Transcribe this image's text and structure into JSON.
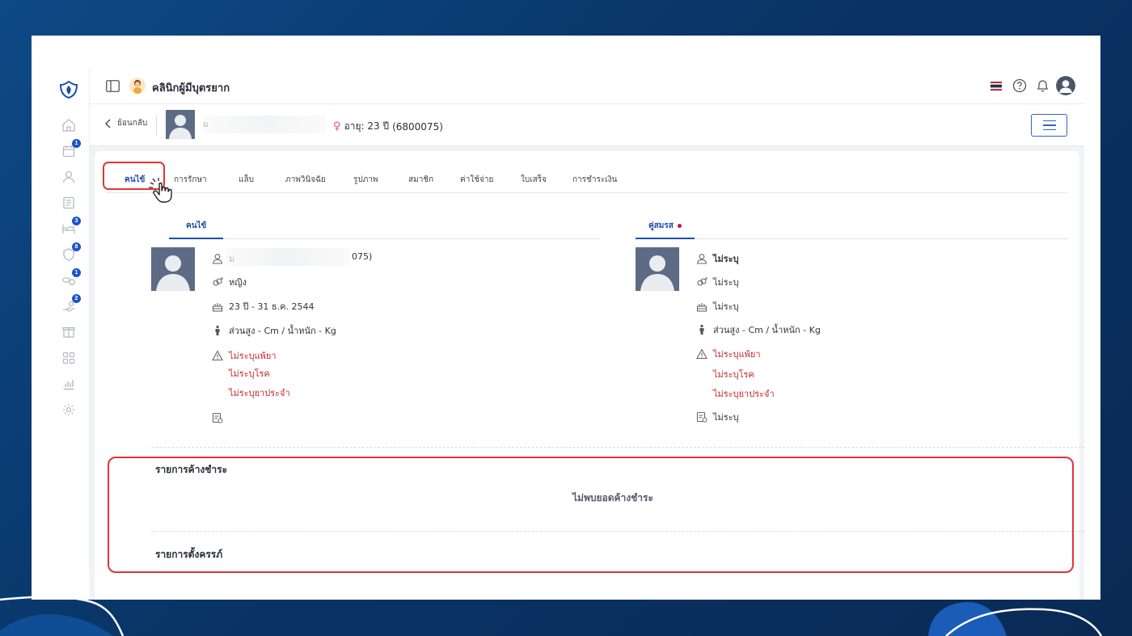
{
  "clinic": {
    "name": "คลินิกผู้มีบุตรยาก"
  },
  "header": {
    "back_label": "ย้อนกลับ",
    "name_initial": "ม",
    "age_text": "อายุ: 23 ปี",
    "hn_text": "(6800075)",
    "gender_symbol": "♀"
  },
  "tabs": [
    {
      "label": "คนไข้",
      "active": true
    },
    {
      "label": "การรักษา"
    },
    {
      "label": "แล็บ"
    },
    {
      "label": "ภาพวินิจฉัย"
    },
    {
      "label": "รูปภาพ"
    },
    {
      "label": "สมาชิก"
    },
    {
      "label": "ค่าใช้จ่าย"
    },
    {
      "label": "ใบเสร็จ"
    },
    {
      "label": "การชำระเงิน"
    }
  ],
  "sidebar": {
    "badges": {
      "appointments": "1",
      "beds": "3",
      "shield": "8",
      "pills": "1",
      "hand": "2"
    }
  },
  "patient": {
    "tab_label": "คนไข้",
    "name_initial": "ม",
    "name_suffix": "075)",
    "gender": "หญิง",
    "birth": "23 ปี - 31 ธ.ค. 2544",
    "body": "ส่วนสูง - Cm / น้ำหนัก - Kg",
    "allergy": "ไม่ระบุแพ้ยา",
    "disease": "ไม่ระบุโรค",
    "medication": "ไม่ระบุยาประจำ",
    "note": ""
  },
  "spouse": {
    "tab_label": "คู่สมรส",
    "name": "ไม่ระบุ",
    "gender": "ไม่ระบุ",
    "birth": "ไม่ระบุ",
    "body": "ส่วนสูง - Cm / น้ำหนัก - Kg",
    "allergy": "ไม่ระบุแพ้ยา",
    "disease": "ไม่ระบุโรค",
    "medication": "ไม่ระบุยาประจำ",
    "note": "ไม่ระบุ"
  },
  "outstanding": {
    "title": "รายการค้างชำระ",
    "empty": "ไม่พบยอดค้างชำระ"
  },
  "pregnancy": {
    "title": "รายการตั้งครรภ์"
  },
  "colors": {
    "accent": "#1d4fa8",
    "warning": "#c62828",
    "highlight": "#e03535",
    "badge": "#1d54c7"
  }
}
